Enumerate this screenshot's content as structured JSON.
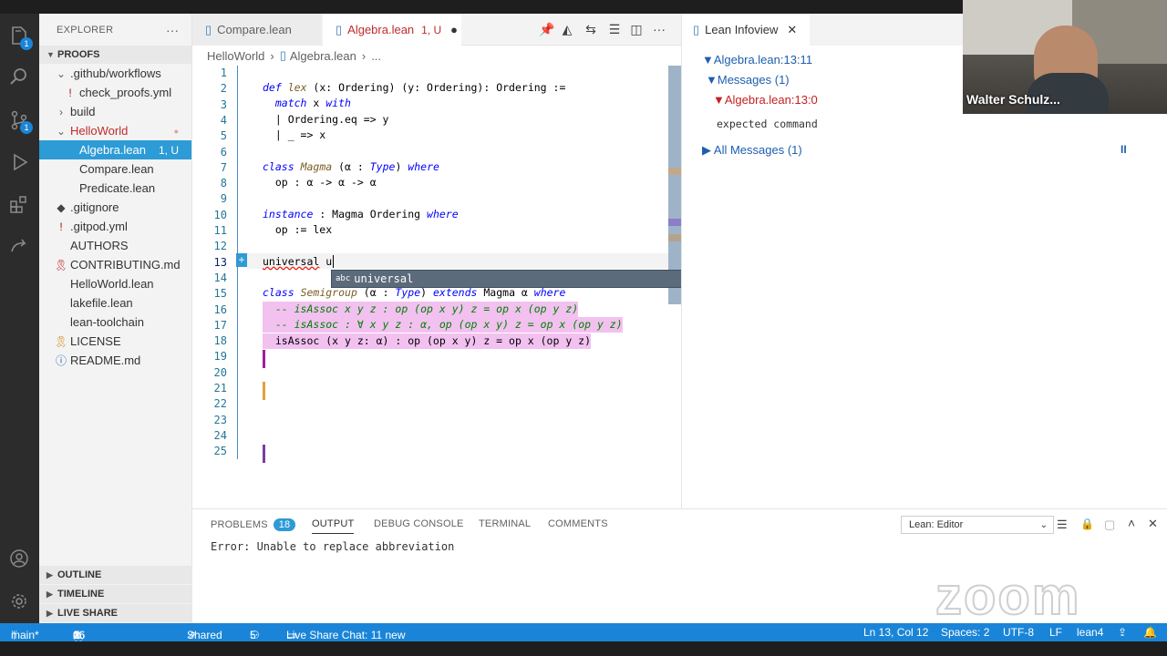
{
  "explorer": {
    "title": "EXPLORER",
    "more": "···",
    "section": "PROOFS",
    "items": [
      {
        "label": ".github/workflows",
        "icon": "folder-chevron"
      },
      {
        "label": "check_proofs.yml",
        "icon": "exclamation"
      },
      {
        "label": "build",
        "icon": "folder-chevron"
      },
      {
        "label": "HelloWorld",
        "icon": "folder-chevron",
        "status": "●"
      },
      {
        "label": "Algebra.lean",
        "status": "1, U"
      },
      {
        "label": "Compare.lean"
      },
      {
        "label": "Predicate.lean"
      },
      {
        "label": ".gitignore",
        "icon": "diamond"
      },
      {
        "label": ".gitpod.yml",
        "icon": "exclamation"
      },
      {
        "label": "AUTHORS"
      },
      {
        "label": "CONTRIBUTING.md",
        "icon": "ribbon"
      },
      {
        "label": "HelloWorld.lean"
      },
      {
        "label": "lakefile.lean"
      },
      {
        "label": "lean-toolchain"
      },
      {
        "label": "LICENSE",
        "icon": "license"
      },
      {
        "label": "README.md",
        "icon": "info"
      }
    ],
    "outline": "OUTLINE",
    "timeline": "TIMELINE",
    "liveshare": "LIVE SHARE"
  },
  "activity": {
    "explorer_badge": "1",
    "scm_badge": "1"
  },
  "tabs": [
    {
      "label": "Compare.lean"
    },
    {
      "label": "Algebra.lean",
      "status": "1, U",
      "dirty": "●"
    }
  ],
  "breadcrumb": {
    "folder": "HelloWorld",
    "file": "Algebra.lean",
    "rest": "..."
  },
  "editor": {
    "line_numbers": [
      "1",
      "2",
      "3",
      "4",
      "5",
      "6",
      "7",
      "8",
      "9",
      "10",
      "11",
      "12",
      "13",
      "14",
      "15",
      "16",
      "17",
      "18",
      "19",
      "20",
      "21",
      "22",
      "23",
      "24",
      "25"
    ],
    "autocomplete": {
      "kind": "abc",
      "label": "universal"
    }
  },
  "infoview": {
    "title": "Lean Infoview",
    "position": "Algebra.lean:13:11",
    "messages_label": "Messages (1)",
    "message_location": "Algebra.lean:13:0",
    "message_text": "expected command",
    "all_messages": "All Messages (1)",
    "pause": "II"
  },
  "video": {
    "name": "Walter Schulz..."
  },
  "panel": {
    "tabs": [
      "PROBLEMS",
      "OUTPUT",
      "DEBUG CONSOLE",
      "TERMINAL",
      "COMMENTS"
    ],
    "problems_count": "18",
    "dropdown": "Lean: Editor",
    "output_text": "Error: Unable to replace abbreviation",
    "watermark": "zoom"
  },
  "status": {
    "branch": "main*",
    "errors": "16",
    "warnings": "0",
    "info": "2",
    "shared": "Shared",
    "participants": "5",
    "chat": "Live Share Chat: 11 new",
    "position": "Ln 13, Col 12",
    "spaces": "Spaces: 2",
    "encoding": "UTF-8",
    "eol": "LF",
    "language": "lean4"
  }
}
